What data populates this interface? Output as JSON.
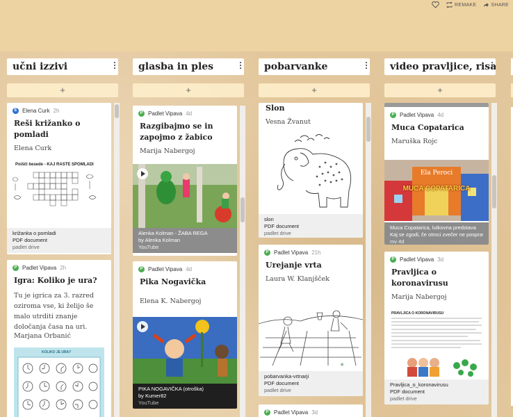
{
  "header": {
    "remake_label": "REMAKE",
    "share_label": "SHARE"
  },
  "columns": [
    {
      "title": "učni izzivi",
      "add_label": "+",
      "cards": [
        {
          "author": "Elena Curk",
          "avatar_letter": "E",
          "avatar_color": "#2a6fd6",
          "time": "2h",
          "title": "Reši križanko o pomladi",
          "subtitle": "Elena Curk",
          "image_heading": "Poišči besede - KAJ RASTE SPOMLADI",
          "attachment_name": "križanka o pomladi",
          "attachment_type": "PDF document",
          "attachment_source": "padlet drive"
        },
        {
          "author": "Padlet Vipava",
          "avatar_letter": "P",
          "avatar_color": "#4caf50",
          "time": "2h",
          "title": "Igra: Koliko je ura?",
          "body": "Tu je igrica za 3. razred oziroma vse, ki želijo še malo utrditi znanje določanja časa na uri.",
          "signature": "Marjana Orbanić",
          "image_heading": "KOLIKO JE URA?"
        }
      ]
    },
    {
      "title": "glasba in ples",
      "add_label": "+",
      "cards": [
        {
          "author": "Padlet Vipava",
          "avatar_letter": "P",
          "avatar_color": "#4caf50",
          "time": "4d",
          "title": "Razgibajmo se in zapojmo z žabico",
          "subtitle": "Marija Nabergoj",
          "attachment_name": "Alenka Kolman - ŽABA REGA",
          "attachment_type": "by Alenka Kolman",
          "attachment_source": "YouTube"
        },
        {
          "author": "Padlet Vipava",
          "avatar_letter": "P",
          "avatar_color": "#4caf50",
          "time": "4d",
          "title": "Pika Nogavička",
          "subtitle": "Elena K. Nabergoj",
          "attachment_name": "PIKA NOGAVIČKA (otroška)",
          "attachment_type": "by Kumer82",
          "attachment_source": "YouTube"
        }
      ]
    },
    {
      "title": "pobarvanke",
      "add_label": "+",
      "cards": [
        {
          "title": "Slon",
          "subtitle": "Vesna Žvanut",
          "attachment_name": "slon",
          "attachment_type": "PDF document",
          "attachment_source": "padlet drive"
        },
        {
          "author": "Padlet Vipava",
          "avatar_letter": "P",
          "avatar_color": "#4caf50",
          "time": "21h",
          "title": "Urejanje vrta",
          "subtitle": "Laura W. Klanjšček",
          "attachment_name": "pobarvanka-vrtnarji",
          "attachment_type": "PDF document",
          "attachment_source": "padlet drive"
        },
        {
          "author": "Padlet Vipava",
          "avatar_letter": "P",
          "avatar_color": "#4caf50",
          "time": "3d"
        }
      ]
    },
    {
      "title": "video pravljice, risanke",
      "add_label": "+",
      "cards": [
        {
          "author": "Padlet Vipava",
          "avatar_letter": "P",
          "avatar_color": "#4caf50",
          "time": "4d",
          "title": "Muca Copatarica",
          "subtitle": "Maruška Rojc",
          "image_caption_top": "Ela Peroci",
          "image_caption_main": "MUCA COPATARICA",
          "attachment_name": "Muca Copatarica, lutkovna predstava",
          "attachment_type": "Kaj se zgodi, če otroci zvečer ne pospravijo svojih...",
          "attachment_source": "mv 4d"
        },
        {
          "author": "Padlet Vipava",
          "avatar_letter": "P",
          "avatar_color": "#4caf50",
          "time": "3d",
          "title": "Pravljica o koronavirusu",
          "subtitle": "Marija Nabergoj",
          "image_heading": "PRAVLJICA O KORONAVIRUSU",
          "attachment_name": "Pravljica_o_koronavirusu",
          "attachment_type": "PDF document",
          "attachment_source": "padlet drive"
        }
      ]
    }
  ]
}
